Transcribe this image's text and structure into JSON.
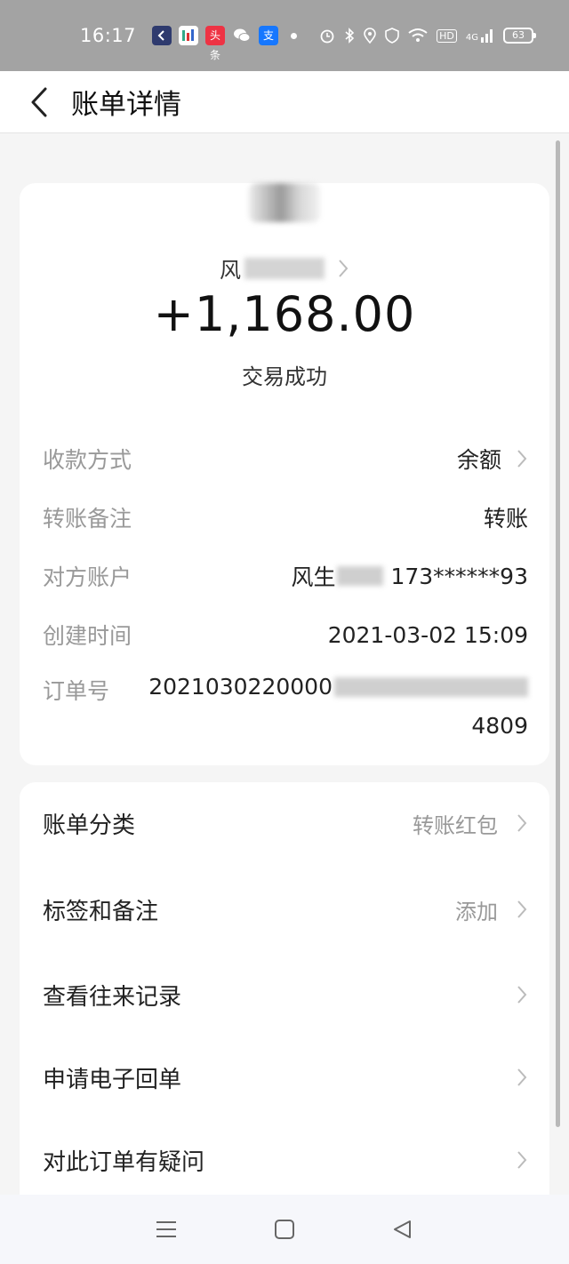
{
  "status_bar": {
    "time": "16:17",
    "battery": "63",
    "network": "4G",
    "hd": "HD",
    "notif_icons": [
      "app-icon",
      "news-icon",
      "toutiao-icon",
      "wechat-icon",
      "alipay-icon"
    ],
    "notif_labels": [
      "",
      "",
      "头条",
      "",
      "支"
    ]
  },
  "header": {
    "title": "账单详情"
  },
  "summary": {
    "counterparty_prefix": "风",
    "amount": "+1,168.00",
    "status": "交易成功"
  },
  "details": {
    "payment_method_label": "收款方式",
    "payment_method_value": "余额",
    "remark_label": "转账备注",
    "remark_value": "转账",
    "account_label": "对方账户",
    "account_name_prefix": "风生",
    "account_phone": "173******93",
    "created_label": "创建时间",
    "created_value": "2021-03-02 15:09",
    "order_label": "订单号",
    "order_prefix": "2021030220000",
    "order_suffix": "4809"
  },
  "menu": {
    "category_label": "账单分类",
    "category_value": "转账红包",
    "tags_label": "标签和备注",
    "tags_value": "添加",
    "history_label": "查看往来记录",
    "receipt_label": "申请电子回单",
    "question_label": "对此订单有疑问"
  },
  "colors": {
    "status_bar": "#a3a3a3",
    "label_gray": "#999999",
    "text_dark": "#222222",
    "card_bg": "#ffffff",
    "page_bg": "#f5f5f5"
  }
}
